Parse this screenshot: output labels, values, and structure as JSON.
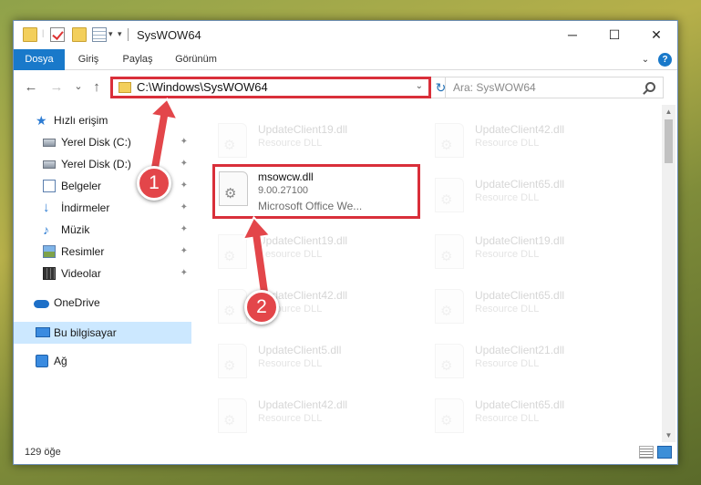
{
  "window": {
    "title": "SysWOW64",
    "controls": {
      "minimize": "─",
      "maximize": "☐",
      "close": "✕"
    }
  },
  "ribbon": {
    "tabs": [
      {
        "label": "Dosya"
      },
      {
        "label": "Giriş"
      },
      {
        "label": "Paylaş"
      },
      {
        "label": "Görünüm"
      }
    ],
    "help": "?"
  },
  "nav": {
    "back": "←",
    "forward": "→",
    "recent": "⌄",
    "up": "↑",
    "address": "C:\\Windows\\SysWOW64",
    "refresh": "↻",
    "search_placeholder": "Ara: SysWOW64"
  },
  "sidebar": {
    "items": [
      {
        "label": "Hızlı erişim",
        "icon": "star-icon"
      },
      {
        "label": "Yerel Disk (C:)",
        "icon": "drive-icon"
      },
      {
        "label": "Yerel Disk (D:)",
        "icon": "drive-icon"
      },
      {
        "label": "Belgeler",
        "icon": "documents-icon"
      },
      {
        "label": "İndirmeler",
        "icon": "downloads-icon"
      },
      {
        "label": "Müzik",
        "icon": "music-icon"
      },
      {
        "label": "Resimler",
        "icon": "pictures-icon"
      },
      {
        "label": "Videolar",
        "icon": "videos-icon"
      },
      {
        "label": "OneDrive",
        "icon": "onedrive-icon"
      },
      {
        "label": "Bu bilgisayar",
        "icon": "this-pc-icon"
      },
      {
        "label": "Ağ",
        "icon": "network-icon"
      }
    ],
    "pin": "📌"
  },
  "files": {
    "col1": [
      {
        "name": "UpdateClient19.dll",
        "type": "Resource DLL"
      },
      {
        "name": "UpdateClient19.dll",
        "type": "Resource DLL"
      },
      {
        "name": "UpdateClient42.dll",
        "type": "Resource DLL"
      },
      {
        "name": "UpdateClient5.dll",
        "type": "Resource DLL"
      },
      {
        "name": "UpdateClient42.dll",
        "type": "Resource DLL"
      }
    ],
    "col2": [
      {
        "name": "UpdateClient42.dll",
        "type": "Resource DLL"
      },
      {
        "name": "UpdateClient65.dll",
        "type": "Resource DLL"
      },
      {
        "name": "UpdateClient19.dll",
        "type": "Resource DLL"
      },
      {
        "name": "UpdateClient65.dll",
        "type": "Resource DLL"
      },
      {
        "name": "UpdateClient21.dll",
        "type": "Resource DLL"
      },
      {
        "name": "UpdateClient65.dll",
        "type": "Resource DLL"
      }
    ],
    "highlighted": {
      "name": "msowcw.dll",
      "version": "9.00.27100",
      "description": "Microsoft Office We..."
    }
  },
  "status": {
    "item_count": "129 öğe"
  },
  "callouts": {
    "one": "1",
    "two": "2"
  },
  "colors": {
    "highlight": "#d92f3a",
    "callout": "#e3464a",
    "accent": "#1979ca"
  }
}
